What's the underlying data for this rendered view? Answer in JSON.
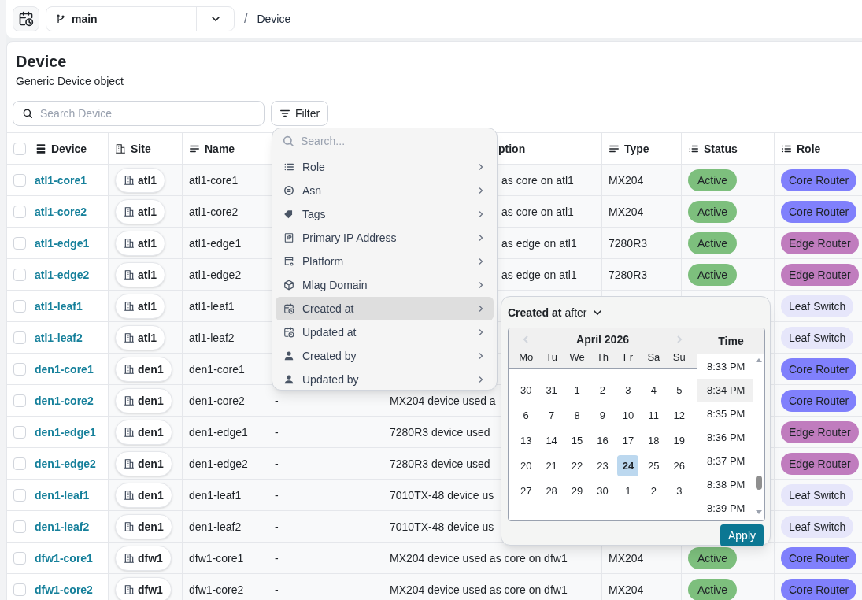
{
  "toolbar": {
    "branch": "main",
    "separator": "/",
    "breadcrumb": "Device"
  },
  "header": {
    "title": "Device",
    "subtitle": "Generic Device object"
  },
  "search": {
    "placeholder": "Search Device"
  },
  "filter_button": "Filter",
  "table": {
    "select_all_checked": false,
    "columns": [
      {
        "label": "Device",
        "kind": "node"
      },
      {
        "label": "Site",
        "kind": "relation"
      },
      {
        "label": "Name",
        "kind": "text"
      },
      {
        "kind": "hidden"
      },
      {
        "label": "ption",
        "kind": "partial"
      },
      {
        "label": "Type",
        "kind": "text"
      },
      {
        "label": "Status",
        "kind": "dropdown"
      },
      {
        "label": "Role",
        "kind": "dropdown"
      }
    ],
    "rows": [
      {
        "checked": false,
        "device": "atl1-core1",
        "site": "atl1",
        "name": "atl1-core1",
        "description": "as core on atl1",
        "type": "MX204",
        "status": "Active",
        "role": {
          "label": "Core Router",
          "color": "#8080fc"
        }
      },
      {
        "checked": false,
        "device": "atl1-core2",
        "site": "atl1",
        "name": "atl1-core2",
        "description": "as core on atl1",
        "type": "MX204",
        "status": "Active",
        "role": {
          "label": "Core Router",
          "color": "#8080fc"
        }
      },
      {
        "checked": false,
        "device": "atl1-edge1",
        "site": "atl1",
        "name": "atl1-edge1",
        "description": "as edge on atl1",
        "type": "7280R3",
        "status": "Active",
        "role": {
          "label": "Edge Router",
          "color": "#c07cbe"
        }
      },
      {
        "checked": false,
        "device": "atl1-edge2",
        "site": "atl1",
        "name": "atl1-edge2",
        "description": "as edge on atl1",
        "type": "7280R3",
        "status": "Active",
        "role": {
          "label": "Edge Router",
          "color": "#c07cbe"
        }
      },
      {
        "checked": false,
        "device": "atl1-leaf1",
        "site": "atl1",
        "name": "atl1-leaf1",
        "role": {
          "label": "Leaf Switch",
          "color": "#e6e6fa"
        }
      },
      {
        "checked": false,
        "device": "atl1-leaf2",
        "site": "atl1",
        "name": "atl1-leaf2",
        "role": {
          "label": "Leaf Switch",
          "color": "#e6e6fa"
        }
      },
      {
        "checked": false,
        "device": "den1-core1",
        "site": "den1",
        "name": "den1-core1",
        "role": {
          "label": "Core Router",
          "color": "#8080fc"
        }
      },
      {
        "checked": false,
        "device": "den1-core2",
        "site": "den1",
        "name": "den1-core2",
        "column_4": "-",
        "description": "MX204 device used a",
        "role": {
          "label": "Core Router",
          "color": "#8080fc"
        }
      },
      {
        "checked": false,
        "device": "den1-edge1",
        "site": "den1",
        "name": "den1-edge1",
        "column_4": "-",
        "description": "7280R3 device used",
        "role": {
          "label": "Edge Router",
          "color": "#c07cbe"
        }
      },
      {
        "checked": false,
        "device": "den1-edge2",
        "site": "den1",
        "name": "den1-edge2",
        "column_4": "-",
        "description": "7280R3 device used",
        "role": {
          "label": "Edge Router",
          "color": "#c07cbe"
        }
      },
      {
        "checked": false,
        "device": "den1-leaf1",
        "site": "den1",
        "name": "den1-leaf1",
        "column_4": "-",
        "description": "7010TX-48 device us",
        "role": {
          "label": "Leaf Switch",
          "color": "#e6e6fa"
        }
      },
      {
        "checked": false,
        "device": "den1-leaf2",
        "site": "den1",
        "name": "den1-leaf2",
        "column_4": "-",
        "description": "7010TX-48 device us",
        "role": {
          "label": "Leaf Switch",
          "color": "#e6e6fa"
        }
      },
      {
        "checked": false,
        "device": "dfw1-core1",
        "site": "dfw1",
        "name": "dfw1-core1",
        "column_4": "-",
        "description": "MX204 device used as core on dfw1",
        "type": "MX204",
        "status": "Active",
        "role": {
          "label": "Core Router",
          "color": "#8080fc"
        }
      },
      {
        "checked": false,
        "device": "dfw1-core2",
        "site": "dfw1",
        "name": "dfw1-core2",
        "column_4": "-",
        "description": "MX204 device used as core on dfw1",
        "type": "MX204",
        "status": "Active",
        "role": {
          "label": "Core Router",
          "color": "#8080fc"
        }
      }
    ]
  },
  "filter_menu": {
    "placeholder": "Search...",
    "items": [
      {
        "label": "Role",
        "kind": "list",
        "selected": false
      },
      {
        "label": "Asn",
        "kind": "asn",
        "selected": false
      },
      {
        "label": "Tags",
        "kind": "tags",
        "selected": false
      },
      {
        "label": "Primary IP Address",
        "kind": "ip",
        "selected": false
      },
      {
        "label": "Platform",
        "kind": "platform",
        "selected": false
      },
      {
        "label": "Mlag Domain",
        "kind": "domain",
        "selected": false
      },
      {
        "label": "Created at",
        "kind": "datetime",
        "selected": true
      },
      {
        "label": "Updated at",
        "kind": "datetime",
        "selected": false
      },
      {
        "label": "Created by",
        "kind": "user",
        "selected": false
      },
      {
        "label": "Updated by",
        "kind": "user",
        "selected": false
      }
    ]
  },
  "date_filter": {
    "field": "Created at",
    "operator": "after",
    "month": "April 2026",
    "weekdays": [
      "Mo",
      "Tu",
      "We",
      "Th",
      "Fr",
      "Sa",
      "Su"
    ],
    "days": [
      {
        "label": "30",
        "selected": false
      },
      {
        "label": "31",
        "selected": false
      },
      {
        "label": "1",
        "selected": false
      },
      {
        "label": "2",
        "selected": false
      },
      {
        "label": "3",
        "selected": false
      },
      {
        "label": "4",
        "selected": false
      },
      {
        "label": "5",
        "selected": false
      },
      {
        "label": "6",
        "selected": false
      },
      {
        "label": "7",
        "selected": false
      },
      {
        "label": "8",
        "selected": false
      },
      {
        "label": "9",
        "selected": false
      },
      {
        "label": "10",
        "selected": false
      },
      {
        "label": "11",
        "selected": false
      },
      {
        "label": "12",
        "selected": false
      },
      {
        "label": "13",
        "selected": false
      },
      {
        "label": "14",
        "selected": false
      },
      {
        "label": "15",
        "selected": false
      },
      {
        "label": "16",
        "selected": false
      },
      {
        "label": "17",
        "selected": false
      },
      {
        "label": "18",
        "selected": false
      },
      {
        "label": "19",
        "selected": false
      },
      {
        "label": "20",
        "selected": false
      },
      {
        "label": "21",
        "selected": false
      },
      {
        "label": "22",
        "selected": false
      },
      {
        "label": "23",
        "selected": false
      },
      {
        "label": "24",
        "selected": true
      },
      {
        "label": "25",
        "selected": false
      },
      {
        "label": "26",
        "selected": false
      },
      {
        "label": "27",
        "selected": false
      },
      {
        "label": "28",
        "selected": false
      },
      {
        "label": "29",
        "selected": false
      },
      {
        "label": "30",
        "selected": false
      },
      {
        "label": "1",
        "selected": false
      },
      {
        "label": "2",
        "selected": false
      },
      {
        "label": "3",
        "selected": false
      }
    ],
    "time_header": "Time",
    "times": [
      {
        "label": "8:33 PM",
        "selected": false
      },
      {
        "label": "8:34 PM",
        "selected": true
      },
      {
        "label": "8:35 PM",
        "selected": false
      },
      {
        "label": "8:36 PM",
        "selected": false
      },
      {
        "label": "8:37 PM",
        "selected": false
      },
      {
        "label": "8:38 PM",
        "selected": false
      },
      {
        "label": "8:39 PM",
        "selected": false
      }
    ],
    "apply": "Apply"
  }
}
